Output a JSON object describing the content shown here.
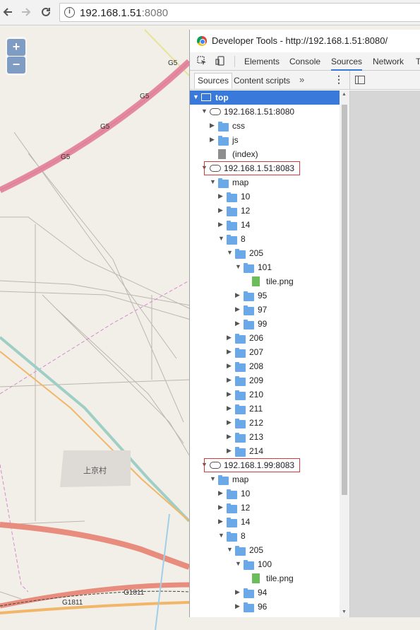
{
  "browser": {
    "url_host": "192.168.1.51",
    "url_port": ":8080"
  },
  "map": {
    "road_labels": [
      "G5",
      "G5",
      "G5",
      "G5",
      "G1811",
      "G1811"
    ],
    "village_label": "上京村",
    "zoom_in": "+",
    "zoom_out": "−"
  },
  "devtools": {
    "title": "Developer Tools - http://192.168.1.51:8080/",
    "tabs": [
      "Elements",
      "Console",
      "Sources",
      "Network",
      "T"
    ],
    "active_tab": "Sources",
    "subtabs": [
      "Sources",
      "Content scripts"
    ],
    "more": "»",
    "kebab": "⋮",
    "tree": [
      {
        "label": "top",
        "depth": 0,
        "type": "frame",
        "expanded": true,
        "selected": true
      },
      {
        "label": "192.168.1.51:8080",
        "depth": 1,
        "type": "origin",
        "expanded": true
      },
      {
        "label": "css",
        "depth": 2,
        "type": "folder",
        "expanded": false
      },
      {
        "label": "js",
        "depth": 2,
        "type": "folder",
        "expanded": false
      },
      {
        "label": "(index)",
        "depth": 2,
        "type": "file"
      },
      {
        "label": "192.168.1.51:8083",
        "depth": 1,
        "type": "origin",
        "expanded": true,
        "highlighted": true
      },
      {
        "label": "map",
        "depth": 2,
        "type": "folder",
        "expanded": true
      },
      {
        "label": "10",
        "depth": 3,
        "type": "folder",
        "expanded": false
      },
      {
        "label": "12",
        "depth": 3,
        "type": "folder",
        "expanded": false
      },
      {
        "label": "14",
        "depth": 3,
        "type": "folder",
        "expanded": false
      },
      {
        "label": "8",
        "depth": 3,
        "type": "folder",
        "expanded": true
      },
      {
        "label": "205",
        "depth": 4,
        "type": "folder",
        "expanded": true
      },
      {
        "label": "101",
        "depth": 5,
        "type": "folder",
        "expanded": true
      },
      {
        "label": "tile.png",
        "depth": 6,
        "type": "png"
      },
      {
        "label": "95",
        "depth": 5,
        "type": "folder",
        "expanded": false
      },
      {
        "label": "97",
        "depth": 5,
        "type": "folder",
        "expanded": false
      },
      {
        "label": "99",
        "depth": 5,
        "type": "folder",
        "expanded": false
      },
      {
        "label": "206",
        "depth": 4,
        "type": "folder",
        "expanded": false
      },
      {
        "label": "207",
        "depth": 4,
        "type": "folder",
        "expanded": false
      },
      {
        "label": "208",
        "depth": 4,
        "type": "folder",
        "expanded": false
      },
      {
        "label": "209",
        "depth": 4,
        "type": "folder",
        "expanded": false
      },
      {
        "label": "210",
        "depth": 4,
        "type": "folder",
        "expanded": false
      },
      {
        "label": "211",
        "depth": 4,
        "type": "folder",
        "expanded": false
      },
      {
        "label": "212",
        "depth": 4,
        "type": "folder",
        "expanded": false
      },
      {
        "label": "213",
        "depth": 4,
        "type": "folder",
        "expanded": false
      },
      {
        "label": "214",
        "depth": 4,
        "type": "folder",
        "expanded": false
      },
      {
        "label": "192.168.1.99:8083",
        "depth": 1,
        "type": "origin",
        "expanded": true,
        "highlighted": true
      },
      {
        "label": "map",
        "depth": 2,
        "type": "folder",
        "expanded": true
      },
      {
        "label": "10",
        "depth": 3,
        "type": "folder",
        "expanded": false
      },
      {
        "label": "12",
        "depth": 3,
        "type": "folder",
        "expanded": false
      },
      {
        "label": "14",
        "depth": 3,
        "type": "folder",
        "expanded": false
      },
      {
        "label": "8",
        "depth": 3,
        "type": "folder",
        "expanded": true
      },
      {
        "label": "205",
        "depth": 4,
        "type": "folder",
        "expanded": true
      },
      {
        "label": "100",
        "depth": 5,
        "type": "folder",
        "expanded": true
      },
      {
        "label": "tile.png",
        "depth": 6,
        "type": "png"
      },
      {
        "label": "94",
        "depth": 5,
        "type": "folder",
        "expanded": false
      },
      {
        "label": "96",
        "depth": 5,
        "type": "folder",
        "expanded": false
      }
    ]
  }
}
